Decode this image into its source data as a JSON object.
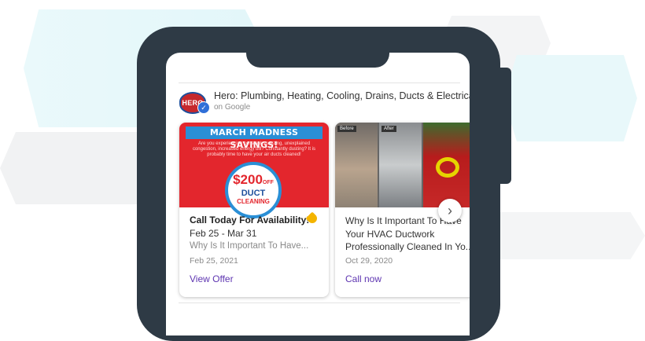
{
  "business": {
    "logo_text": "HERO",
    "name": "Hero: Plumbing, Heating, Cooling, Drains, Ducts & Electrical",
    "source": "on Google"
  },
  "posts": [
    {
      "image": {
        "banner": "MARCH MADNESS SAVINGS!",
        "body": "Are you experiencing constant sneezing, unexplained congestion, increased energy bill? Constantly dusting? It is probably time to have your air ducts cleaned!",
        "price": "$200",
        "price_suffix": "OFF",
        "label_line1": "DUCT",
        "label_line2": "CLEANING"
      },
      "title": "Call Today For Availability!",
      "dates": "Feb 25 - Mar 31",
      "subtitle": "Why Is It Important To Have...",
      "posted": "Feb 25, 2021",
      "cta": "View Offer",
      "icon": "offer-tag-icon"
    },
    {
      "image": {
        "before_label": "Before",
        "after_label": "After"
      },
      "title": "Why Is It Important To Have Your HVAC Ductwork Professionally Cleaned In Yo...",
      "posted": "Oct 29, 2020",
      "cta": "Call now"
    }
  ],
  "carousel": {
    "next_icon": "chevron-right-icon",
    "next_glyph": "›"
  },
  "colors": {
    "phone": "#2e3a45",
    "cta": "#5e35b1",
    "promo_red": "#e3262d",
    "promo_blue": "#2a8fd6",
    "verified": "#2f6fd8"
  }
}
